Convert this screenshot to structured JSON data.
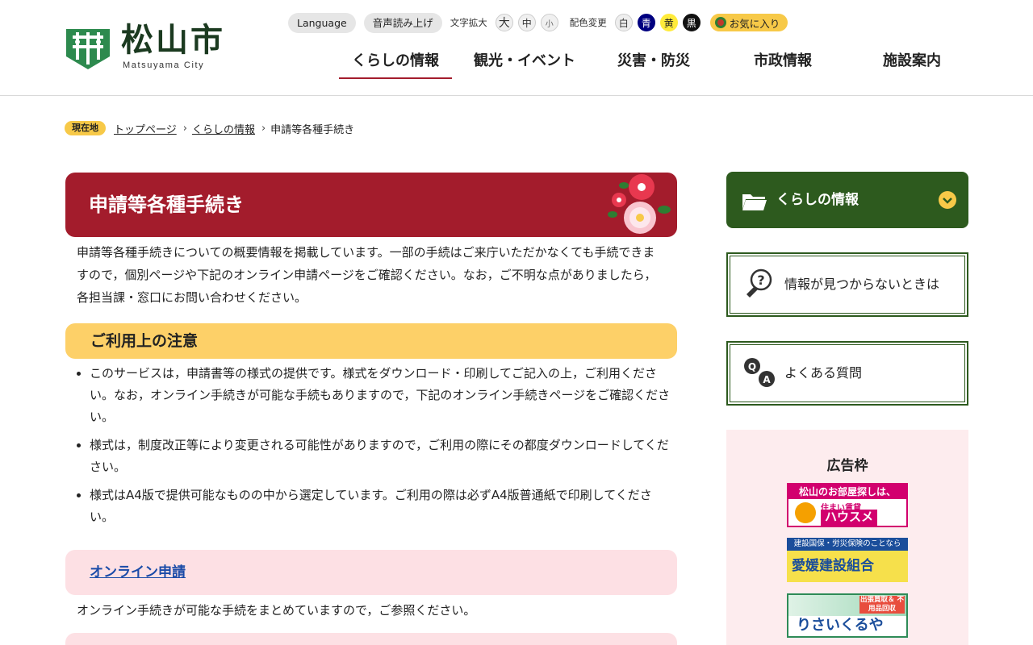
{
  "header": {
    "logo_text": "松山市",
    "logo_sub": "Matsuyama City",
    "utility": {
      "language": "Language",
      "voice": "音声読み上げ",
      "text_size_label": "文字拡大",
      "text_size_large": "大",
      "text_size_medium": "中",
      "text_size_small": "小",
      "color_label": "配色変更",
      "color_white": "白",
      "color_blue": "青",
      "color_yellow": "黄",
      "color_black": "黒",
      "favorites": "お気に入り"
    },
    "nav": [
      {
        "label": "くらしの情報"
      },
      {
        "label": "観光・イベント"
      },
      {
        "label": "災害・防災"
      },
      {
        "label": "市政情報"
      },
      {
        "label": "施設案内"
      }
    ]
  },
  "breadcrumb": {
    "badge": "現在地",
    "items": [
      "トップページ",
      "くらしの情報",
      "申請等各種手続き"
    ]
  },
  "main": {
    "title": "申請等各種手続き",
    "intro": "申請等各種手続きについての概要情報を掲載しています。一部の手続はご来庁いただかなくても手続できますので，個別ページや下記のオンライン申請ページをご確認ください。なお，ご不明な点がありましたら，各担当課・窓口にお問い合わせください。",
    "notice_heading": "ご利用上の注意",
    "notes": [
      "このサービスは，申請書等の様式の提供です。様式をダウンロード・印刷してご記入の上，ご利用ください。なお，オンライン手続きが可能な手続もありますので，下記のオンライン手続きページをご確認ください。",
      "様式は，制度改正等により変更される可能性がありますので，ご利用の際にその都度ダウンロードしてください。",
      "様式はA4版で提供可能なものの中から選定しています。ご利用の際は必ずA4版普通紙で印刷してください。"
    ],
    "online_heading": "オンライン申請",
    "online_desc": "オンライン手続きが可能な手続をまとめていますので，ご参照ください。"
  },
  "sidebar": {
    "category": "くらしの情報",
    "not_found": "情報が見つからないときは",
    "faq": "よくある質問",
    "ads_title": "広告枠",
    "ads": [
      {
        "line1": "松山のお部屋探しは、",
        "line2": "住まい賃貸",
        "line3": "ハウスメイト"
      },
      {
        "line1": "建設国保・労災保険のことなら",
        "line2": "愛媛建設組合"
      },
      {
        "line1": "出張買取＆ 不用品回収",
        "line2": "りさいくるや"
      }
    ]
  },
  "colors": {
    "brand_green": "#2d5a1e",
    "title_red": "#a31c2c",
    "accent_yellow": "#f7c948",
    "heading_yellow": "#fdd068",
    "pink": "#fde0e4",
    "link_blue": "#1a4ba8"
  }
}
